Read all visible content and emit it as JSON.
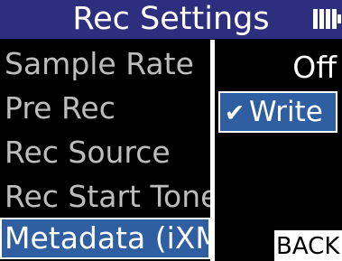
{
  "header": {
    "title": "Rec Settings",
    "battery_icon": "battery-icon"
  },
  "menu": {
    "items": [
      {
        "label": "Sample Rate",
        "selected": false
      },
      {
        "label": "Pre Rec",
        "selected": false
      },
      {
        "label": "Rec Source",
        "selected": false
      },
      {
        "label": "Rec Start Tone",
        "selected": false
      },
      {
        "label": "Metadata (iXML)",
        "selected": true
      }
    ]
  },
  "options": {
    "off_label": "Off",
    "write_label": "Write",
    "check_icon": "check-icon"
  },
  "back_label": "BACK",
  "colors": {
    "header_bg": "#2e2e7e",
    "highlight_bg": "#2f5fa0",
    "text_dim": "#bdbdbd",
    "text_bright": "#ffffff",
    "background": "#000000"
  }
}
